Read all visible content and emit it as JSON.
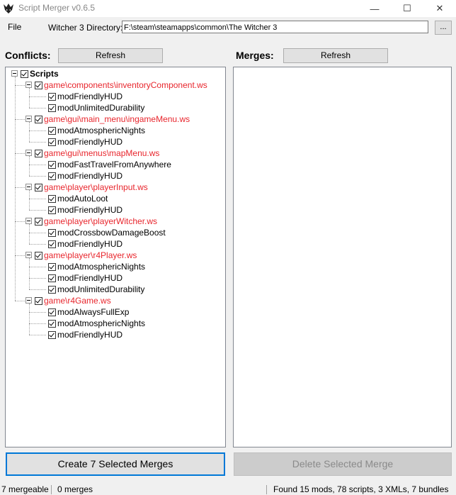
{
  "window": {
    "title": "Script Merger v0.6.5",
    "min": "—",
    "max": "☐",
    "close": "✕"
  },
  "menu": {
    "file": "File"
  },
  "directory": {
    "label": "Witcher 3 Directory:",
    "value": "F:\\steam\\steamapps\\common\\The Witcher 3",
    "browse": "..."
  },
  "conflicts": {
    "label": "Conflicts:",
    "refresh": "Refresh"
  },
  "merges": {
    "label": "Merges:",
    "refresh": "Refresh"
  },
  "tree": {
    "root": "Scripts",
    "files": [
      {
        "path": "game\\components\\inventoryComponent.ws",
        "mods": [
          "modFriendlyHUD",
          "modUnlimitedDurability"
        ]
      },
      {
        "path": "game\\gui\\main_menu\\ingameMenu.ws",
        "mods": [
          "modAtmosphericNights",
          "modFriendlyHUD"
        ]
      },
      {
        "path": "game\\gui\\menus\\mapMenu.ws",
        "mods": [
          "modFastTravelFromAnywhere",
          "modFriendlyHUD"
        ]
      },
      {
        "path": "game\\player\\playerInput.ws",
        "mods": [
          "modAutoLoot",
          "modFriendlyHUD"
        ]
      },
      {
        "path": "game\\player\\playerWitcher.ws",
        "mods": [
          "modCrossbowDamageBoost",
          "modFriendlyHUD"
        ]
      },
      {
        "path": "game\\player\\r4Player.ws",
        "mods": [
          "modAtmosphericNights",
          "modFriendlyHUD",
          "modUnlimitedDurability"
        ]
      },
      {
        "path": "game\\r4Game.ws",
        "mods": [
          "modAlwaysFullExp",
          "modAtmosphericNights",
          "modFriendlyHUD"
        ]
      }
    ]
  },
  "actions": {
    "create": "Create 7 Selected Merges",
    "delete": "Delete Selected Merge"
  },
  "status": {
    "mergeable": "7 mergeable",
    "merges": "0 merges",
    "found": "Found 15 mods, 78 scripts, 3 XMLs, 7 bundles"
  },
  "colors": {
    "conflict_file": "#e8262d",
    "focus": "#0078d7"
  }
}
